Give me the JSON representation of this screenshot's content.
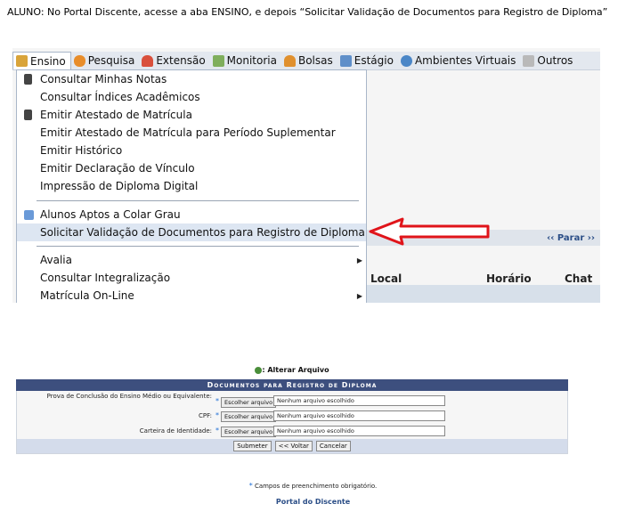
{
  "instruction": "ALUNO: No Portal Discente, acesse a aba ENSINO, e depois “Solicitar Validação de Documentos para Registro de Diploma”",
  "menu": {
    "items": [
      {
        "label": "Ensino",
        "icon": "books-icon"
      },
      {
        "label": "Pesquisa",
        "icon": "flask-icon"
      },
      {
        "label": "Extensão",
        "icon": "heart-icon"
      },
      {
        "label": "Monitoria",
        "icon": "monitor-icon"
      },
      {
        "label": "Bolsas",
        "icon": "person-icon"
      },
      {
        "label": "Estágio",
        "icon": "calendar-icon"
      },
      {
        "label": "Ambientes Virtuais",
        "icon": "globe-icon"
      },
      {
        "label": "Outros",
        "icon": "stack-icon"
      }
    ]
  },
  "dropdown": {
    "items": [
      "Consultar Minhas Notas",
      "Consultar Índices Acadêmicos",
      "Emitir Atestado de Matrícula",
      "Emitir Atestado de Matrícula para Período Suplementar",
      "Emitir Histórico",
      "Emitir Declaração de Vínculo",
      "Impressão de Diploma Digital",
      "Alunos Aptos a Colar Grau",
      "Solicitar Validação de Documentos para Registro de Diploma",
      "Avalia",
      "Consultar Integralização",
      "Matrícula On-Line"
    ]
  },
  "background": {
    "parar": "‹‹ Parar ››",
    "col_local": "Local",
    "col_horario": "Horário",
    "col_chat": "Chat"
  },
  "form": {
    "title": ": Alterar Arquivo",
    "header": "Documentos para Registro de Diploma",
    "rows": [
      {
        "label": "Prova de Conclusão do Ensino Médio ou Equivalente:",
        "button": "Escolher arquivo",
        "file": "Nenhum arquivo escolhido"
      },
      {
        "label": "CPF:",
        "button": "Escolher arquivo",
        "file": "Nenhum arquivo escolhido"
      },
      {
        "label": "Carteira de Identidade:",
        "button": "Escolher arquivo",
        "file": "Nenhum arquivo escolhido"
      }
    ],
    "submit": "Submeter",
    "back": "<< Voltar",
    "cancel": "Cancelar",
    "required_note": "Campos de preenchimento obrigatório.",
    "required_star": "*",
    "portal_link": "Portal do Discente"
  },
  "colors": {
    "menu_bg": "#e3e8ef",
    "header_bg": "#3d4f7e",
    "highlight": "#dde6f2",
    "arrow_red": "#e0141a",
    "link_blue": "#2b4e87"
  }
}
